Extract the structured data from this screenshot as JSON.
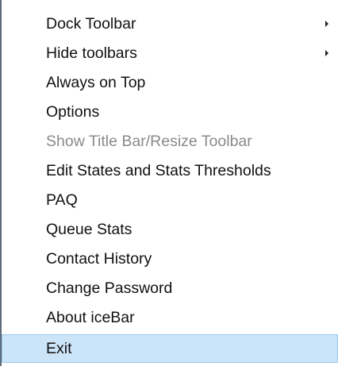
{
  "menu": {
    "items": [
      {
        "label": "Dock Toolbar",
        "submenu": true,
        "enabled": true
      },
      {
        "label": "Hide toolbars",
        "submenu": true,
        "enabled": true
      },
      {
        "label": "Always on Top",
        "submenu": false,
        "enabled": true
      },
      {
        "label": "Options",
        "submenu": false,
        "enabled": true
      },
      {
        "label": "Show Title Bar/Resize Toolbar",
        "submenu": false,
        "enabled": false
      },
      {
        "label": "Edit States and Stats Thresholds",
        "submenu": false,
        "enabled": true
      },
      {
        "label": "PAQ",
        "submenu": false,
        "enabled": true
      },
      {
        "label": "Queue Stats",
        "submenu": false,
        "enabled": true
      },
      {
        "label": "Contact History",
        "submenu": false,
        "enabled": true
      },
      {
        "label": "Change Password",
        "submenu": false,
        "enabled": true
      },
      {
        "label": "About iceBar",
        "submenu": false,
        "enabled": true
      },
      {
        "label": "Exit",
        "submenu": false,
        "enabled": true,
        "highlighted": true
      }
    ],
    "colors": {
      "highlight_background": "#cce4f7",
      "highlight_border": "#99c9ef",
      "disabled_text": "#8a8a8a",
      "left_border": "#5f6b7a"
    }
  }
}
